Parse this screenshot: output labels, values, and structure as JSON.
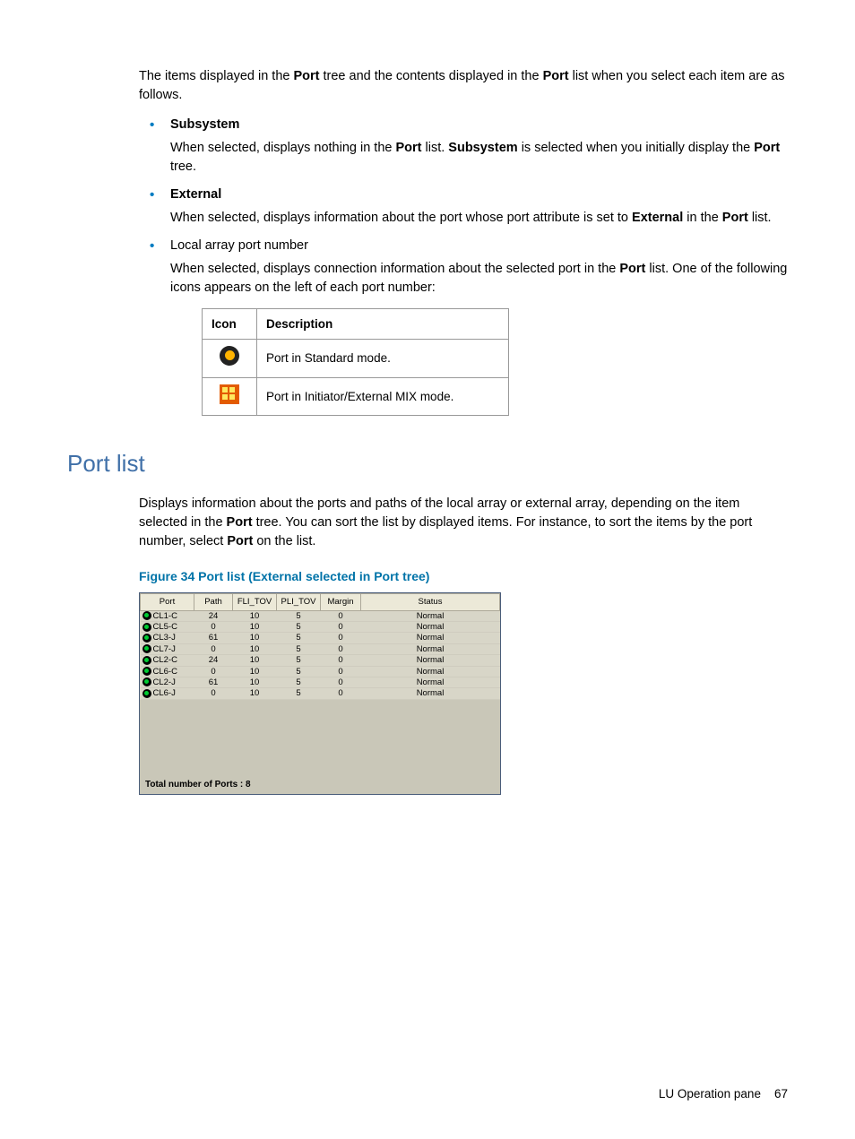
{
  "intro": {
    "pre1": "The items displayed in the ",
    "b1": "Port",
    "mid1": " tree and the contents displayed in the ",
    "b2": "Port",
    "post1": " list when you select each item are as follows."
  },
  "bullets": [
    {
      "title": "Subsystem",
      "desc_parts": [
        "When selected, displays nothing in the ",
        "Port",
        " list. ",
        "Subsystem",
        " is selected when you initially display the ",
        "Port",
        " tree."
      ],
      "bold_title": true
    },
    {
      "title": "External",
      "desc_parts": [
        "When selected, displays information about the port whose port attribute is set to ",
        "External",
        " in the ",
        "Port",
        " list."
      ],
      "bold_title": true
    },
    {
      "title": "Local array port number",
      "desc_parts": [
        "When selected, displays connection information about the selected port in the ",
        "Port",
        " list. One of the following icons appears on the left of each port number:"
      ],
      "bold_title": false
    }
  ],
  "icon_table": {
    "headers": [
      "Icon",
      "Description"
    ],
    "rows": [
      {
        "desc": "Port in Standard mode."
      },
      {
        "desc": "Port in Initiator/External MIX mode."
      }
    ]
  },
  "section_heading": "Port list",
  "section_desc": {
    "p1": "Displays information about the ports and paths of the local array or external array, depending on the item selected in the ",
    "b1": "Port",
    "p2": " tree. You can sort the list by displayed items. For instance, to sort the items by the port number, select ",
    "b2": "Port",
    "p3": " on the list."
  },
  "figure_caption": "Figure 34 Port list (External selected in Port tree)",
  "chart_data": {
    "type": "table",
    "headers": [
      "Port",
      "Path",
      "FLI_TOV",
      "PLI_TOV",
      "Margin",
      "Status"
    ],
    "rows": [
      {
        "port": "CL1-C",
        "path": "24",
        "fli": "10",
        "pli": "5",
        "margin": "0",
        "status": "Normal"
      },
      {
        "port": "CL5-C",
        "path": "0",
        "fli": "10",
        "pli": "5",
        "margin": "0",
        "status": "Normal"
      },
      {
        "port": "CL3-J",
        "path": "61",
        "fli": "10",
        "pli": "5",
        "margin": "0",
        "status": "Normal"
      },
      {
        "port": "CL7-J",
        "path": "0",
        "fli": "10",
        "pli": "5",
        "margin": "0",
        "status": "Normal"
      },
      {
        "port": "CL2-C",
        "path": "24",
        "fli": "10",
        "pli": "5",
        "margin": "0",
        "status": "Normal"
      },
      {
        "port": "CL6-C",
        "path": "0",
        "fli": "10",
        "pli": "5",
        "margin": "0",
        "status": "Normal"
      },
      {
        "port": "CL2-J",
        "path": "61",
        "fli": "10",
        "pli": "5",
        "margin": "0",
        "status": "Normal"
      },
      {
        "port": "CL6-J",
        "path": "0",
        "fli": "10",
        "pli": "5",
        "margin": "0",
        "status": "Normal"
      }
    ],
    "footer_label": "Total number of Ports : ",
    "footer_value": "8"
  },
  "page_footer": {
    "section": "LU Operation pane",
    "page": "67"
  }
}
